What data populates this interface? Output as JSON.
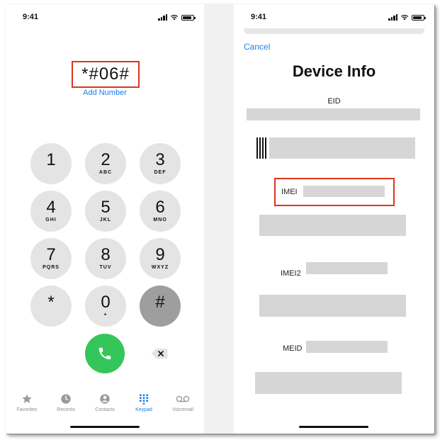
{
  "status": {
    "time": "9:41"
  },
  "dialer": {
    "dialed_number": "*#06#",
    "add_number": "Add Number",
    "keys": [
      {
        "digit": "1",
        "letters": ""
      },
      {
        "digit": "2",
        "letters": "ABC"
      },
      {
        "digit": "3",
        "letters": "DEF"
      },
      {
        "digit": "4",
        "letters": "GHI"
      },
      {
        "digit": "5",
        "letters": "JKL"
      },
      {
        "digit": "6",
        "letters": "MNO"
      },
      {
        "digit": "7",
        "letters": "PQRS"
      },
      {
        "digit": "8",
        "letters": "TUV"
      },
      {
        "digit": "9",
        "letters": "WXYZ"
      },
      {
        "digit": "*",
        "letters": ""
      },
      {
        "digit": "0",
        "letters": "+"
      },
      {
        "digit": "#",
        "letters": ""
      }
    ]
  },
  "tabbar": {
    "tabs": [
      {
        "label": "Favorites",
        "icon": "star-icon"
      },
      {
        "label": "Recents",
        "icon": "clock-icon"
      },
      {
        "label": "Contacts",
        "icon": "person-icon"
      },
      {
        "label": "Keypad",
        "icon": "keypad-icon",
        "active": true
      },
      {
        "label": "Voicemail",
        "icon": "voicemail-icon"
      }
    ]
  },
  "device_info": {
    "cancel": "Cancel",
    "title": "Device Info",
    "eid_label": "EID",
    "imei_label": "IMEI",
    "imei2_label": "IMEI2",
    "meid_label": "MEID"
  },
  "colors": {
    "accent": "#1e7ee6",
    "highlight": "#d9361f",
    "call_green": "#35c659",
    "key_bg": "#e4e4e4",
    "redacted": "#d6d6d6"
  }
}
